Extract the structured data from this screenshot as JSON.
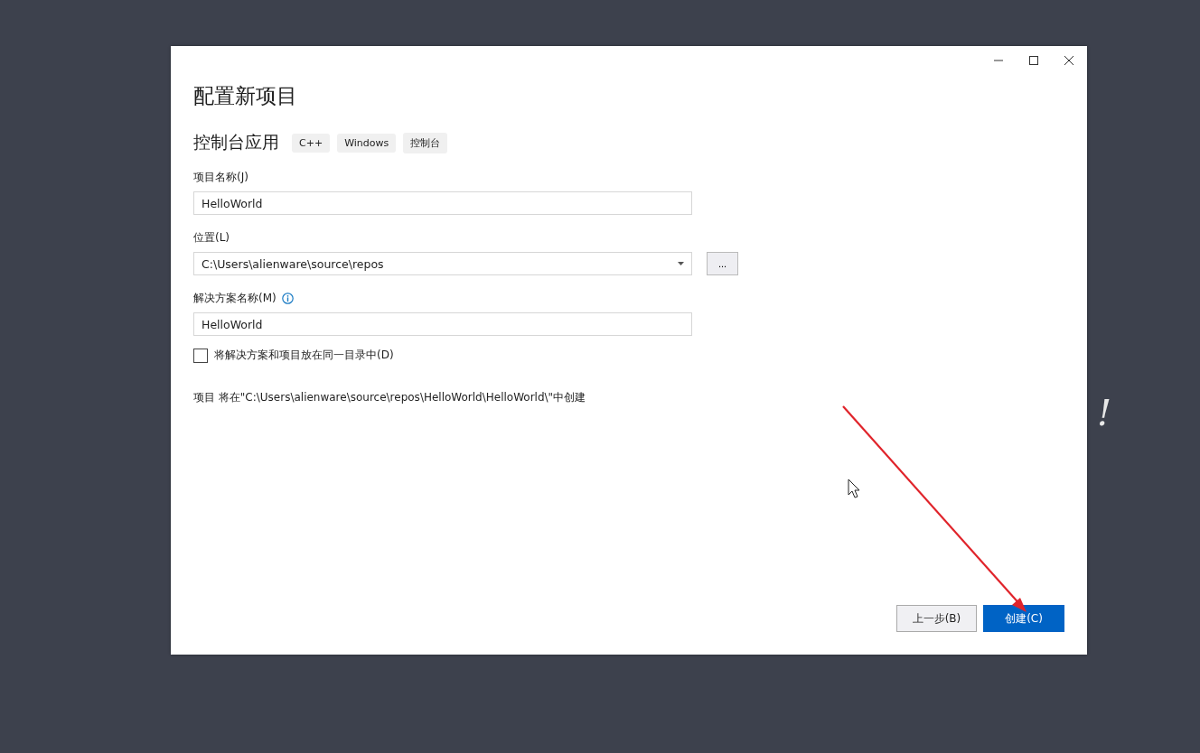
{
  "background_text": "!",
  "window": {
    "controls": [
      {
        "kind": "minimize"
      },
      {
        "kind": "maximize"
      },
      {
        "kind": "close"
      }
    ]
  },
  "title": "配置新项目",
  "template": {
    "name": "控制台应用",
    "tags": [
      "C++",
      "Windows",
      "控制台"
    ]
  },
  "fields": [
    {
      "kind": "text",
      "label": "项目名称(J)",
      "value": "HelloWorld",
      "info": false
    },
    {
      "kind": "dropdown",
      "label": "位置(L)",
      "value": "C:\\Users\\alienware\\source\\repos",
      "info": false,
      "browse_button": "..."
    },
    {
      "kind": "text",
      "label": "解决方案名称(M)",
      "value": "HelloWorld",
      "info": true
    }
  ],
  "same_directory": {
    "label": "将解决方案和项目放在同一目录中(D)",
    "checked": false
  },
  "path_note": "项目 将在\"C:\\Users\\alienware\\source\\repos\\HelloWorld\\HelloWorld\\\"中创建",
  "buttons": [
    {
      "label": "上一步(B)",
      "primary": false
    },
    {
      "label": "创建(C)",
      "primary": true
    }
  ]
}
